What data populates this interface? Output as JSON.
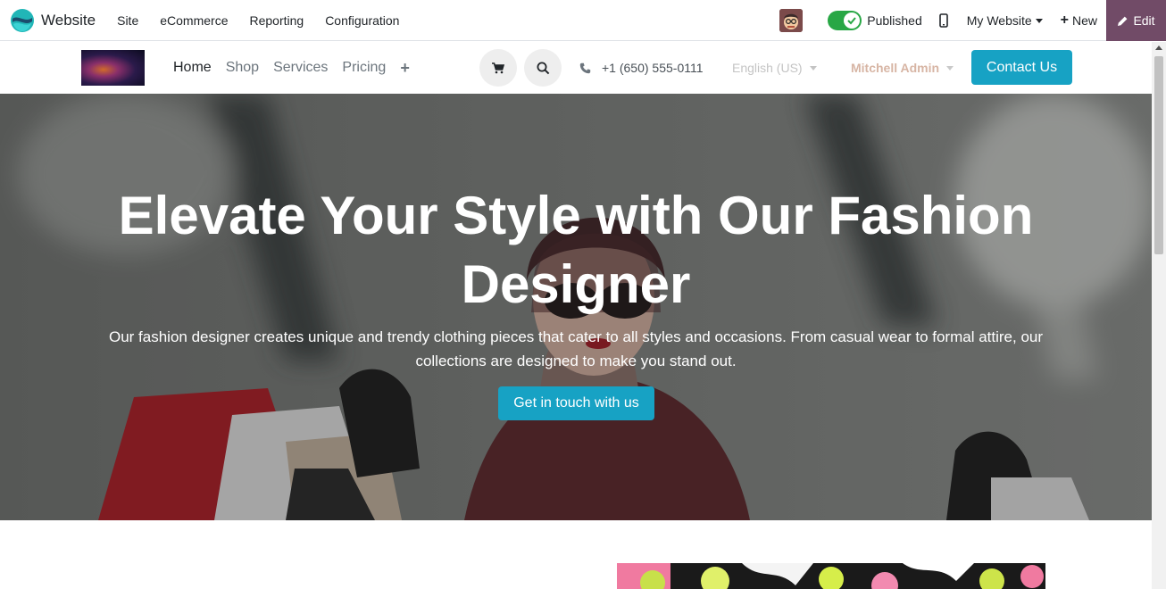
{
  "admin_bar": {
    "app_title": "Website",
    "menu": [
      "Site",
      "eCommerce",
      "Reporting",
      "Configuration"
    ],
    "published_label": "Published",
    "my_website_label": "My Website",
    "new_label": "New",
    "edit_label": "Edit",
    "toggle_on": true,
    "accent_color": "#714b67",
    "toggle_color": "#28a745"
  },
  "site_header": {
    "nav": [
      "Home",
      "Shop",
      "Services",
      "Pricing"
    ],
    "active_nav": "Home",
    "phone": "+1 (650) 555-0111",
    "language": "English (US)",
    "user": "Mitchell Admin",
    "contact_label": "Contact Us",
    "button_color": "#17a2c4"
  },
  "hero": {
    "title": "Elevate Your Style with Our Fashion Designer",
    "text": "Our fashion designer creates unique and trendy clothing pieces that cater to all styles and occasions. From casual wear to formal attire, our collections are designed to make you stand out.",
    "cta_label": "Get in touch with us"
  },
  "icons": {
    "cart": "shopping-cart-icon",
    "search": "search-icon",
    "phone": "phone-icon",
    "mobile": "mobile-icon",
    "edit": "pencil-icon",
    "add_page": "plus-icon"
  }
}
